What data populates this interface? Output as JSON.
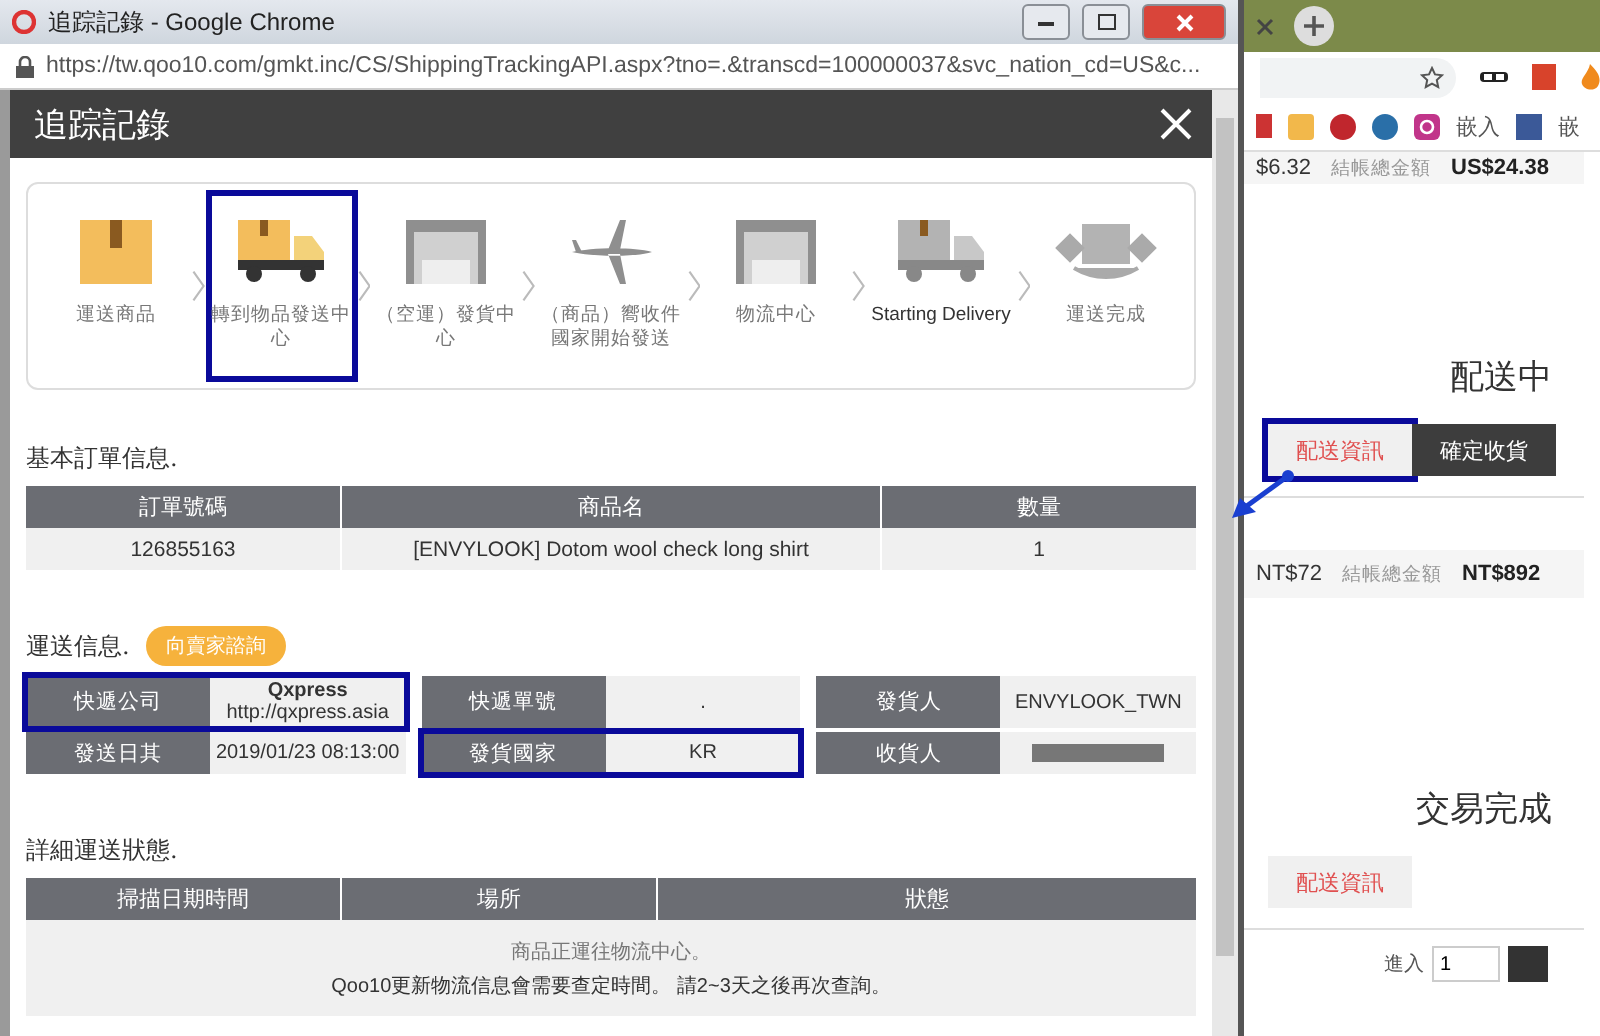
{
  "window": {
    "title": "追踪記錄 - Google Chrome",
    "url": "https://tw.qoo10.com/gmkt.inc/CS/ShippingTrackingAPI.aspx?tno=.&transcd=100000037&svc_nation_cd=US&c..."
  },
  "dialog": {
    "title": "追踪記錄"
  },
  "steps": [
    {
      "label": "運送商品",
      "kind": "box",
      "done": true,
      "highlighted": false
    },
    {
      "label": "轉到物品發送中心",
      "kind": "truck",
      "done": true,
      "highlighted": true
    },
    {
      "label": "（空運）發貨中心",
      "kind": "warehouse",
      "done": false,
      "highlighted": false
    },
    {
      "label": "（商品）嚮收件國家開始發送",
      "kind": "plane",
      "done": false,
      "highlighted": false
    },
    {
      "label": "物流中心",
      "kind": "warehouse",
      "done": false,
      "highlighted": false
    },
    {
      "label": "Starting Delivery",
      "kind": "truck",
      "done": false,
      "highlighted": false
    },
    {
      "label": "運送完成",
      "kind": "handover",
      "done": false,
      "highlighted": false
    }
  ],
  "order_info": {
    "title": "基本訂單信息.",
    "columns": [
      "訂單號碼",
      "商品名",
      "數量"
    ],
    "rows": [
      [
        "126855163",
        "[ENVYLOOK] Dotom wool check long shirt",
        "1"
      ]
    ]
  },
  "shipping_info": {
    "title": "運送信息.",
    "contact_button": "向賣家諮詢",
    "rows": [
      [
        {
          "label": "快遞公司",
          "value": "Qxpress",
          "link": "http://qxpress.asia",
          "highlighted": true,
          "redacted": false
        },
        {
          "label": "快遞單號",
          "value": ".",
          "highlighted": false,
          "redacted": false
        },
        {
          "label": "發貨人",
          "value": "ENVYLOOK_TWN",
          "highlighted": false,
          "redacted": false
        }
      ],
      [
        {
          "label": "發送日其",
          "value": "2019/01/23 08:13:00",
          "highlighted": false,
          "redacted": false
        },
        {
          "label": "發貨國家",
          "value": "KR",
          "highlighted": true,
          "redacted": false
        },
        {
          "label": "收貨人",
          "highlighted": false,
          "redacted": true
        }
      ]
    ]
  },
  "detail": {
    "title": "詳細運送狀態.",
    "columns": [
      "掃描日期時間",
      "場所",
      "狀態"
    ],
    "message": [
      "商品正運往物流中心。",
      "Qoo10更新物流信息會需要查定時間。 請2~3天之後再次查詢。"
    ]
  },
  "background_page": {
    "bookmark_labels": [
      "嵌入",
      "嵌"
    ],
    "top_summary": {
      "amount": "$6.32",
      "total_label": "結帳總金額",
      "total": "US$24.38"
    },
    "orders": [
      {
        "status": "配送中",
        "buttons": [
          {
            "label": "配送資訊",
            "kind": "light",
            "highlighted": true
          },
          {
            "label": "確定收貨",
            "kind": "dark",
            "highlighted": false
          }
        ],
        "summary": {
          "amount": "NT$72",
          "total_label": "結帳總金額",
          "total": "NT$892"
        }
      },
      {
        "status": "交易完成",
        "buttons": [
          {
            "label": "配送資訊",
            "kind": "light",
            "highlighted": false
          }
        ]
      }
    ],
    "quantity": {
      "label": "進入",
      "value": "1"
    }
  }
}
